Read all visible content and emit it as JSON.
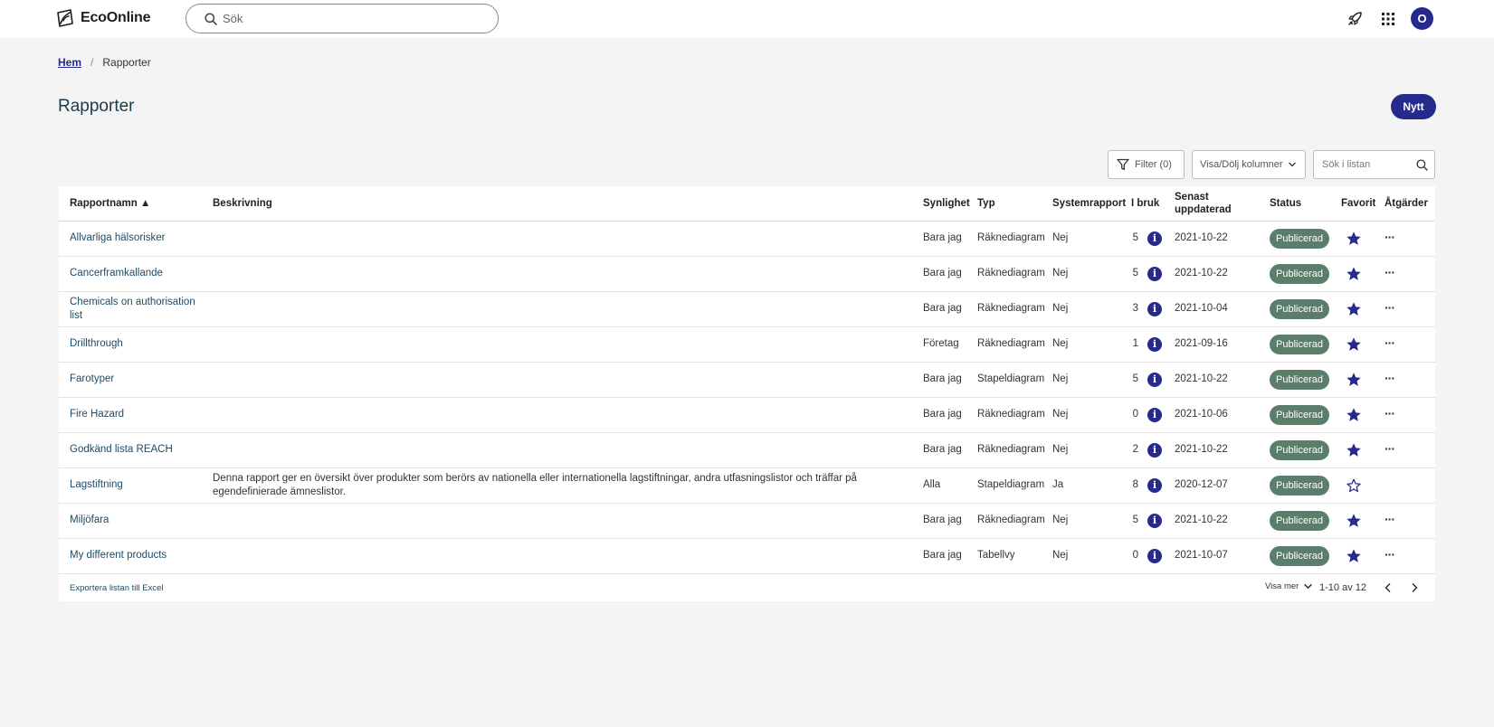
{
  "app": {
    "brand": "EcoOnline",
    "search_placeholder": "Sök",
    "avatar_initial": "O"
  },
  "breadcrumb": {
    "home": "Hem",
    "separator": "/",
    "current": "Rapporter"
  },
  "page": {
    "title": "Rapporter",
    "new_button": "Nytt"
  },
  "toolbar": {
    "filter_label": "Filter (0)",
    "columns_label": "Visa/Dölj kolumner",
    "list_search_placeholder": "Sök i listan"
  },
  "table": {
    "headers": {
      "name": "Rapportnamn ▲",
      "description": "Beskrivning",
      "visibility": "Synlighet",
      "type": "Typ",
      "system": "Systemrapport",
      "in_use": "I bruk",
      "updated": "Senast uppdaterad",
      "status": "Status",
      "favorite": "Favorit",
      "actions": "Åtgärder"
    },
    "rows": [
      {
        "name": "Allvarliga hälsorisker",
        "description": "",
        "visibility": "Bara jag",
        "type": "Räknediagram",
        "system": "Nej",
        "in_use": "5",
        "updated": "2021-10-22",
        "status": "Publicerad",
        "favorite": true,
        "actions": "···"
      },
      {
        "name": "Cancerframkallande",
        "description": "",
        "visibility": "Bara jag",
        "type": "Räknediagram",
        "system": "Nej",
        "in_use": "5",
        "updated": "2021-10-22",
        "status": "Publicerad",
        "favorite": true,
        "actions": "···"
      },
      {
        "name": "Chemicals on authorisation list",
        "description": "",
        "visibility": "Bara jag",
        "type": "Räknediagram",
        "system": "Nej",
        "in_use": "3",
        "updated": "2021-10-04",
        "status": "Publicerad",
        "favorite": true,
        "actions": "···"
      },
      {
        "name": "Drillthrough",
        "description": "",
        "visibility": "Företag",
        "type": "Räknediagram",
        "system": "Nej",
        "in_use": "1",
        "updated": "2021-09-16",
        "status": "Publicerad",
        "favorite": true,
        "actions": "···"
      },
      {
        "name": "Farotyper",
        "description": "",
        "visibility": "Bara jag",
        "type": "Stapeldiagram",
        "system": "Nej",
        "in_use": "5",
        "updated": "2021-10-22",
        "status": "Publicerad",
        "favorite": true,
        "actions": "···"
      },
      {
        "name": "Fire Hazard",
        "description": "",
        "visibility": "Bara jag",
        "type": "Räknediagram",
        "system": "Nej",
        "in_use": "0",
        "updated": "2021-10-06",
        "status": "Publicerad",
        "favorite": true,
        "actions": "···"
      },
      {
        "name": "Godkänd lista REACH",
        "description": "",
        "visibility": "Bara jag",
        "type": "Räknediagram",
        "system": "Nej",
        "in_use": "2",
        "updated": "2021-10-22",
        "status": "Publicerad",
        "favorite": true,
        "actions": "···"
      },
      {
        "name": "Lagstiftning",
        "description": "Denna rapport ger en översikt över produkter som berörs av nationella eller internationella lagstiftningar, andra utfasningslistor och träffar på egendefinierade ämneslistor.",
        "visibility": "Alla",
        "type": "Stapeldiagram",
        "system": "Ja",
        "in_use": "8",
        "updated": "2020-12-07",
        "status": "Publicerad",
        "favorite": false,
        "actions": ""
      },
      {
        "name": "Miljöfara",
        "description": "",
        "visibility": "Bara jag",
        "type": "Räknediagram",
        "system": "Nej",
        "in_use": "5",
        "updated": "2021-10-22",
        "status": "Publicerad",
        "favorite": true,
        "actions": "···"
      },
      {
        "name": "My different products",
        "description": "",
        "visibility": "Bara jag",
        "type": "Tabellvy",
        "system": "Nej",
        "in_use": "0",
        "updated": "2021-10-07",
        "status": "Publicerad",
        "favorite": true,
        "actions": "···"
      }
    ]
  },
  "footer": {
    "export_label": "Exportera listan till Excel",
    "show_more_label": "Visa mer",
    "page_range": "1-10 av 12"
  },
  "colors": {
    "primary": "#262a8c",
    "status_badge": "#5b7e6b",
    "link": "#1f4a66",
    "background": "#f4f4f4"
  }
}
